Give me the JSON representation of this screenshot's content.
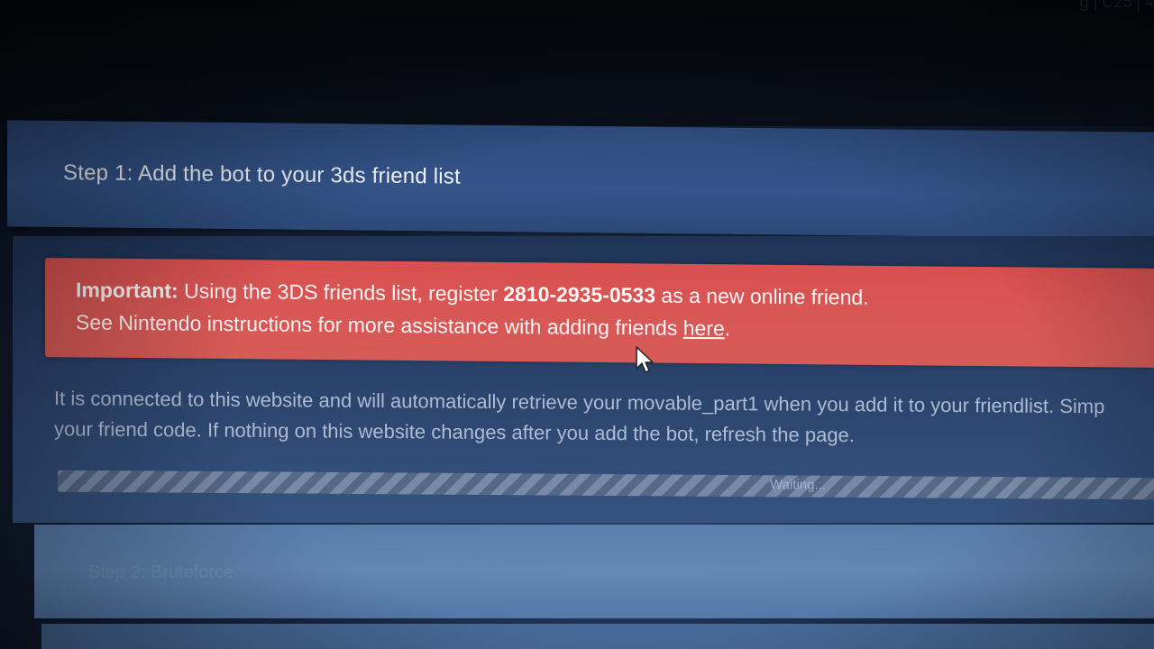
{
  "top_bar": {
    "corner_text": "g | C25 | 4"
  },
  "step1": {
    "title": "Step 1: Add the bot to your 3ds friend list",
    "alert": {
      "important_label": "Important:",
      "line1_pre": " Using the 3DS friends list, register ",
      "friend_code": "2810-2935-0533",
      "line1_post": " as a new online friend.",
      "line2_pre": "See Nintendo instructions for more assistance with adding friends ",
      "link_text": "here",
      "line2_post": "."
    },
    "description_line1": "It is connected to this website and will automatically retrieve your movable_part1 when you add it to your friendlist. Simp",
    "description_line2": "your friend code. If nothing on this website changes after you add the bot, refresh the page.",
    "progress_label": "Waiting..."
  },
  "step2": {
    "title": "Step 2: Bruteforce"
  },
  "colors": {
    "alert_bg": "#d8504f",
    "header_bg": "#2e4b7c"
  }
}
